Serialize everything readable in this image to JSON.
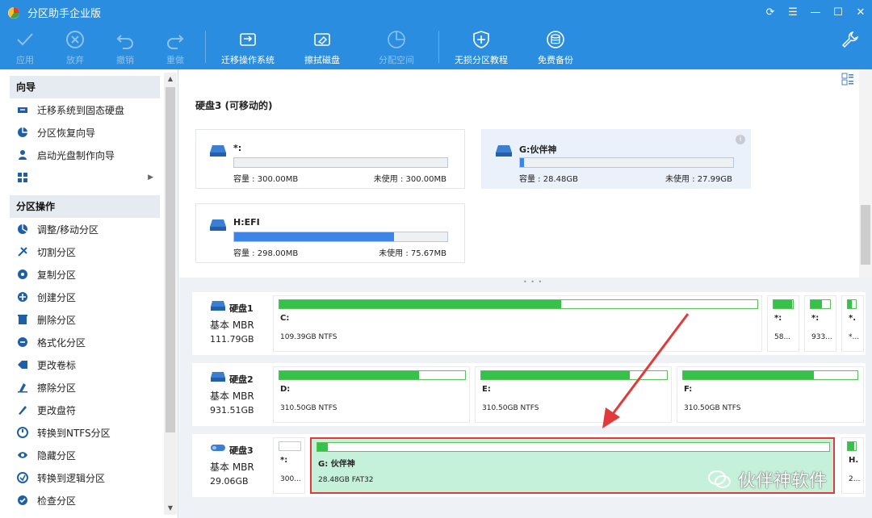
{
  "app": {
    "title": "分区助手企业版"
  },
  "toolbar": {
    "apply": "应用",
    "discard": "放弃",
    "undo": "撤销",
    "redo": "重做",
    "migrate": "迁移操作系统",
    "wipe": "擦拭磁盘",
    "allocate": "分配空间",
    "tutorial": "无损分区教程",
    "backup": "免费备份"
  },
  "sidebar": {
    "wizard_header": "向导",
    "wizard_items": [
      {
        "label": "迁移系统到固态硬盘",
        "icon": "migrate-icon"
      },
      {
        "label": "分区恢复向导",
        "icon": "recovery-icon"
      },
      {
        "label": "启动光盘制作向导",
        "icon": "bootdisk-icon"
      }
    ],
    "ops_header": "分区操作",
    "ops_items": [
      {
        "label": "调整/移动分区",
        "icon": "resize-icon"
      },
      {
        "label": "切割分区",
        "icon": "split-icon"
      },
      {
        "label": "复制分区",
        "icon": "copy-icon"
      },
      {
        "label": "创建分区",
        "icon": "create-icon"
      },
      {
        "label": "删除分区",
        "icon": "delete-icon"
      },
      {
        "label": "格式化分区",
        "icon": "format-icon"
      },
      {
        "label": "更改卷标",
        "icon": "label-icon"
      },
      {
        "label": "擦除分区",
        "icon": "wipe-icon"
      },
      {
        "label": "更改盘符",
        "icon": "letter-icon"
      },
      {
        "label": "转换到NTFS分区",
        "icon": "convert-icon"
      },
      {
        "label": "隐藏分区",
        "icon": "hide-icon"
      },
      {
        "label": "转换到逻辑分区",
        "icon": "logical-icon"
      },
      {
        "label": "检查分区",
        "icon": "check-icon"
      }
    ]
  },
  "top_panel": {
    "disk_title": "硬盘3 (可移动的)",
    "cards": [
      {
        "name": "*:",
        "capacity": "容量 : 300.00MB",
        "free": "未使用 : 300.00MB",
        "used_fraction": 0.0
      },
      {
        "name": "G:伙伴神",
        "capacity": "容量 : 28.48GB",
        "free": "未使用 : 27.99GB",
        "used_fraction": 0.02
      },
      {
        "name": "H:EFI",
        "capacity": "容量 : 298.00MB",
        "free": "未使用 : 75.67MB",
        "used_fraction": 0.75
      }
    ]
  },
  "disks": [
    {
      "name": "硬盘1",
      "type": "基本 MBR",
      "size": "111.79GB",
      "partitions": [
        {
          "label": "C:",
          "info": "109.39GB NTFS",
          "used_fraction": 0.59
        },
        {
          "label": "*:",
          "info": "58...",
          "used_fraction": 0.95
        },
        {
          "label": "*:",
          "info": "933...",
          "used_fraction": 0.6
        },
        {
          "label": "*.",
          "info": "*...",
          "used_fraction": 0.5
        }
      ]
    },
    {
      "name": "硬盘2",
      "type": "基本 MBR",
      "size": "931.51GB",
      "partitions": [
        {
          "label": "D:",
          "info": "310.50GB NTFS",
          "used_fraction": 0.75
        },
        {
          "label": "E:",
          "info": "310.50GB NTFS",
          "used_fraction": 0.8
        },
        {
          "label": "F:",
          "info": "310.50GB NTFS",
          "used_fraction": 0.75
        }
      ]
    },
    {
      "name": "硬盘3",
      "type": "基本 MBR",
      "size": "29.06GB",
      "partitions": [
        {
          "label": "*:",
          "info": "300...",
          "used_fraction": 0.0
        },
        {
          "label": "G: 伙伴神",
          "info": "28.48GB FAT32",
          "used_fraction": 0.02
        },
        {
          "label": "H.",
          "info": "2...",
          "used_fraction": 0.75
        }
      ]
    }
  ],
  "watermark": "伙伴神软件",
  "colors": {
    "accent": "#2a8de0",
    "used": "#36c24a",
    "selected_bg": "#c5f1da",
    "highlight": "#e23a3a"
  }
}
